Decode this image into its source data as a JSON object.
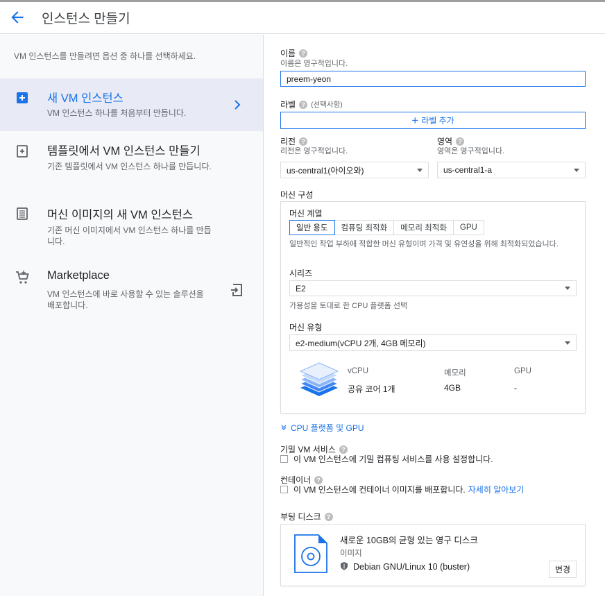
{
  "header": {
    "title": "인스턴스 만들기"
  },
  "left": {
    "description": "VM 인스턴스를 만들려면 옵션 중 하나를 선택하세요.",
    "options": [
      {
        "title": "새 VM 인스턴스",
        "desc": "VM 인스턴스 하나를 처음부터 만듭니다."
      },
      {
        "title": "템플릿에서 VM 인스턴스 만들기",
        "desc": "기존 템플릿에서 VM 인스턴스 하나를 만듭니다."
      },
      {
        "title": "머신 이미지의 새 VM 인스턴스",
        "desc": "기존 머신 이미지에서 VM 인스턴스 하나를 만듭니다."
      },
      {
        "title": "Marketplace",
        "desc": "VM 인스턴스에 바로 사용할 수 있는 솔루션을 배포합니다."
      }
    ]
  },
  "form": {
    "name_label": "이름",
    "name_help": "이름은 영구적입니다.",
    "name_value": "preem-yeon",
    "labels_label": "라벨",
    "labels_optional": "(선택사항)",
    "add_label_button": "라벨 추가",
    "region_label": "리전",
    "region_help": "리전은 영구적입니다.",
    "region_value": "us-central1(아이오와)",
    "zone_label": "영역",
    "zone_help": "영역은 영구적입니다.",
    "zone_value": "us-central1-a",
    "machine_config_label": "머신 구성",
    "machine_family_label": "머신 계열",
    "tabs": [
      "일반 용도",
      "컴퓨팅 최적화",
      "메모리 최적화",
      "GPU"
    ],
    "tab_desc": "일반적인 작업 부하에 적합한 머신 유형이며 가격 및 유연성을 위해 최적화되었습니다.",
    "series_label": "시리즈",
    "series_value": "E2",
    "series_help": "가용성을 토대로 한 CPU 플랫폼 선택",
    "machine_type_label": "머신 유형",
    "machine_type_value": "e2-medium(vCPU 2개, 4GB 메모리)",
    "spec": {
      "vcpu_h": "vCPU",
      "vcpu_v": "공유 코어 1개",
      "mem_h": "메모리",
      "mem_v": "4GB",
      "gpu_h": "GPU",
      "gpu_v": "-"
    },
    "cpu_platform_link": "CPU 플랫폼 및 GPU",
    "confidential_label": "기밀 VM 서비스",
    "confidential_check": "이 VM 인스턴스에 기밀 컴퓨팅 서비스를 사용 설정합니다.",
    "container_label": "컨테이너",
    "container_check": "이 VM 인스턴스에 컨테이너 이미지를 배포합니다.",
    "learn_more": "자세히 알아보기",
    "boot_disk_label": "부팅 디스크",
    "disk_title": "새로운 10GB의 균형 있는 영구 디스크",
    "disk_image_label": "이미지",
    "disk_image_value": "Debian GNU/Linux 10 (buster)",
    "change_button": "변경"
  },
  "colors": {
    "accent": "#1a73e8",
    "selected_bg": "#e8eaf6",
    "sidebar_bg": "#f8f9fa"
  }
}
